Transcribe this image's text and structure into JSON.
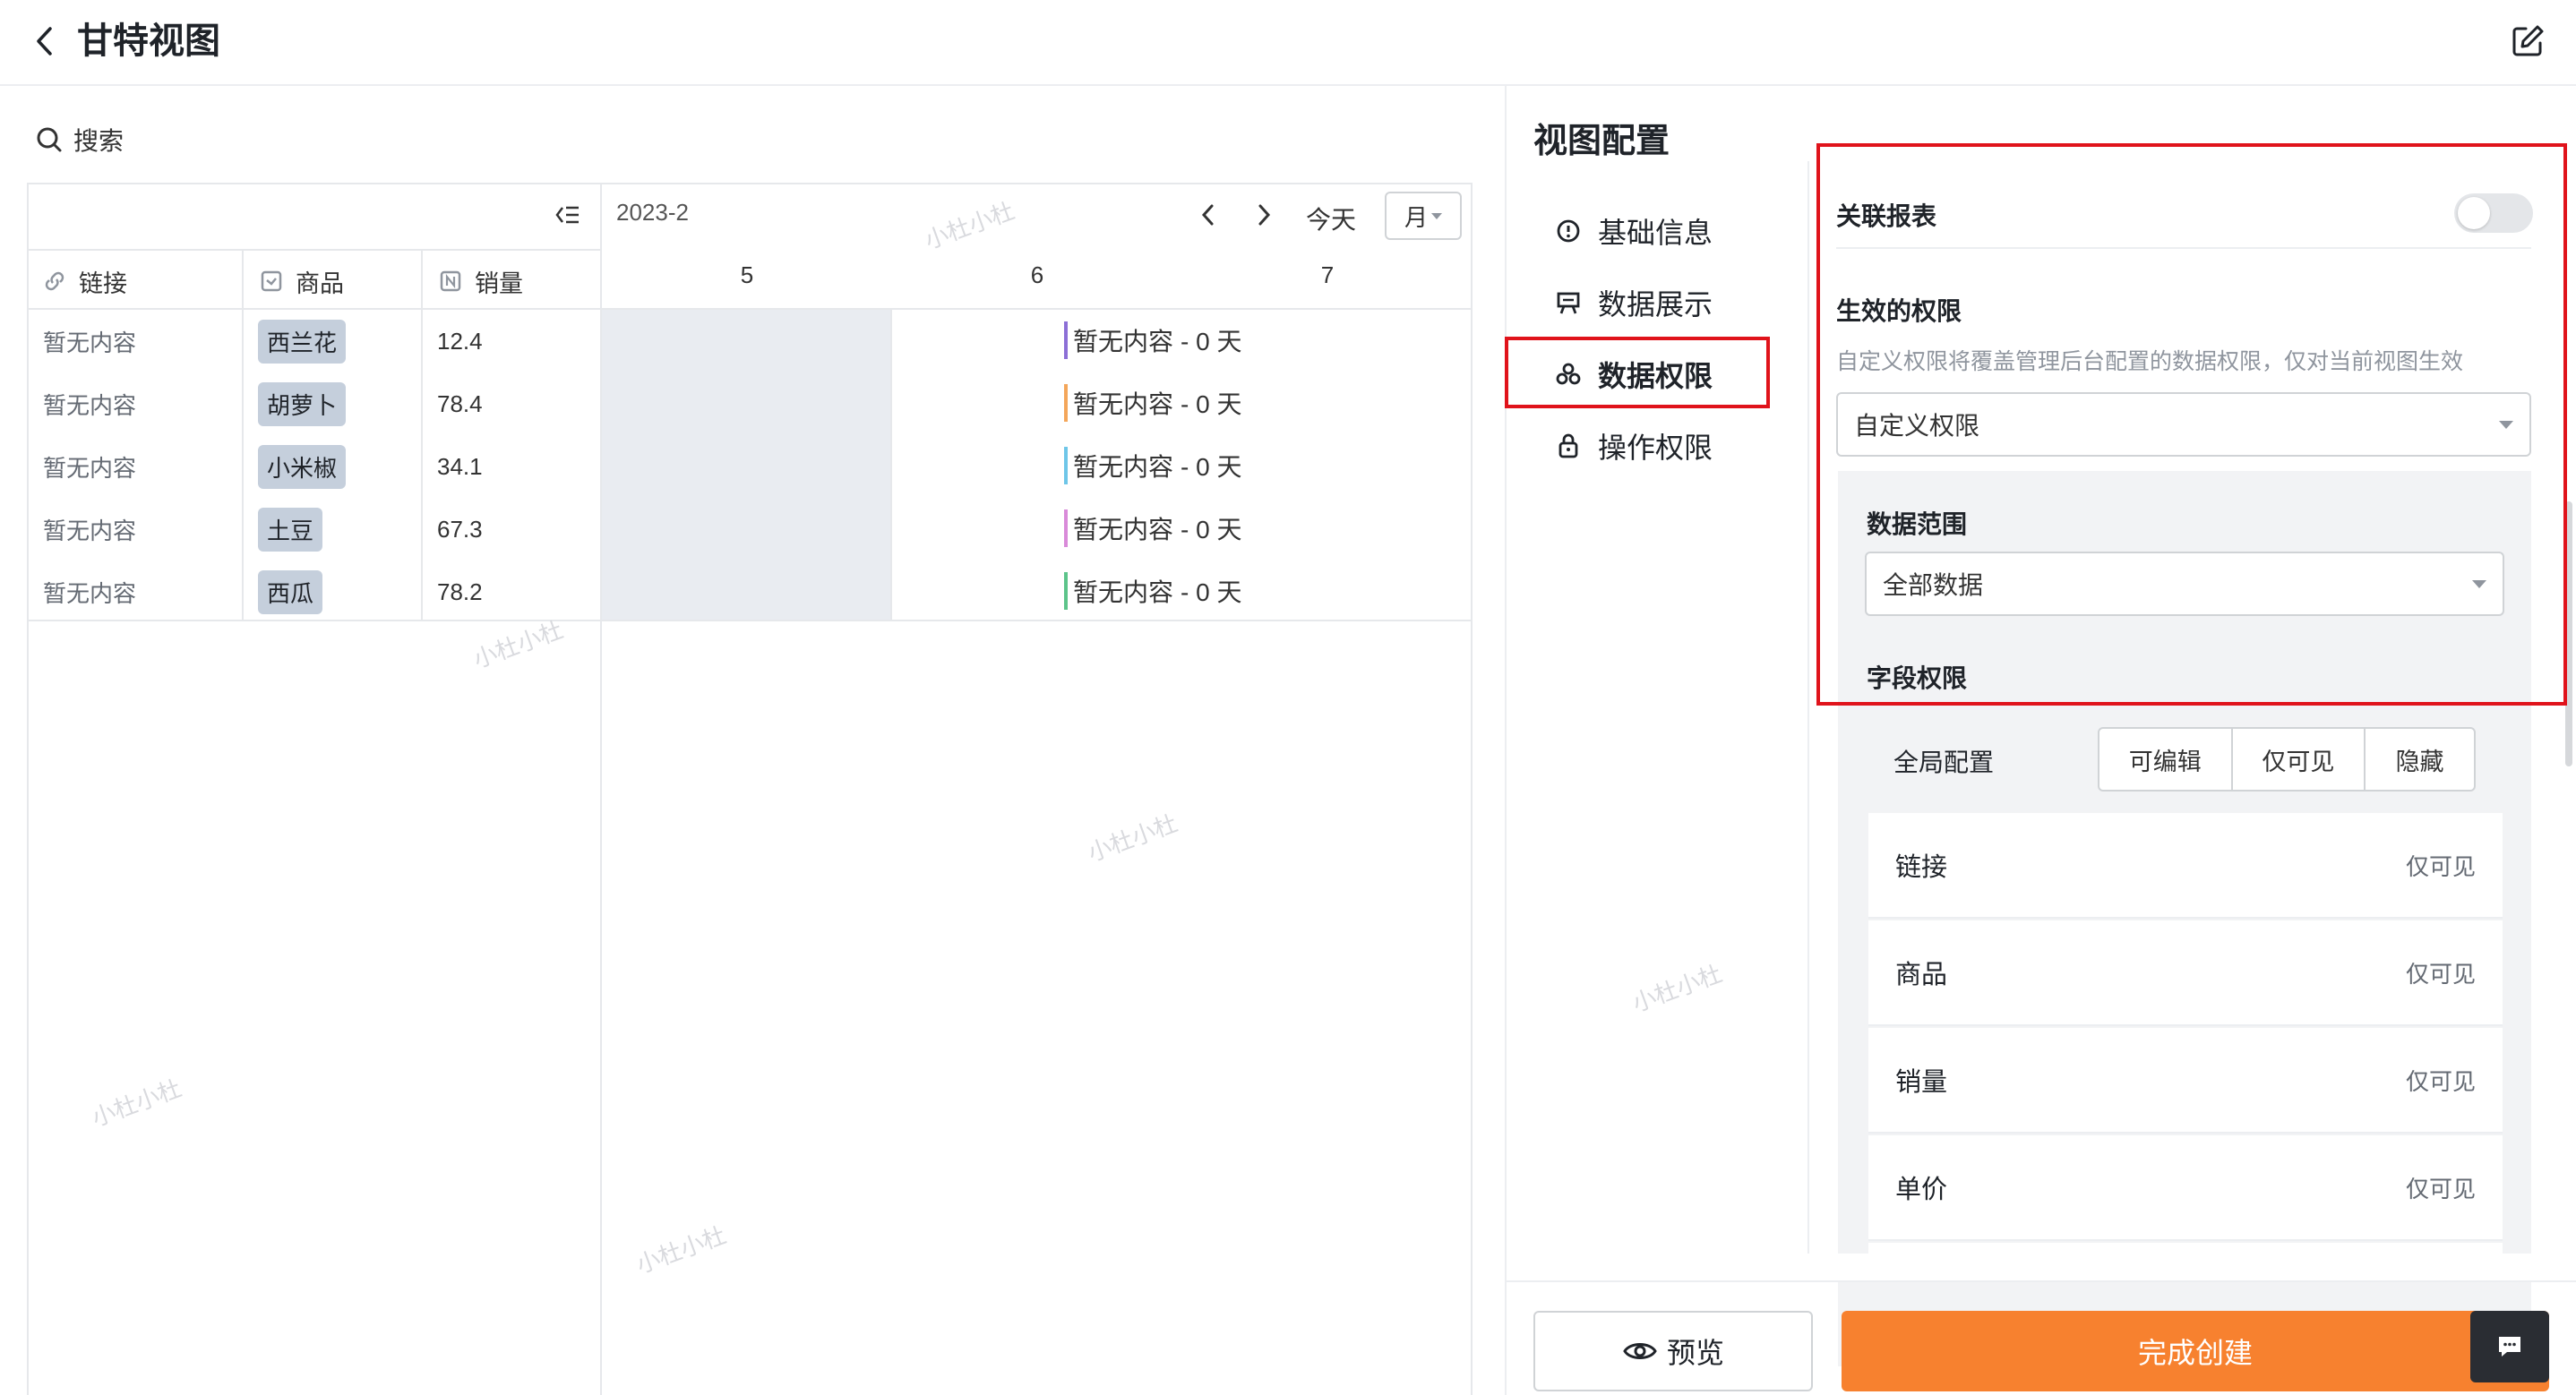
{
  "header": {
    "title": "甘特视图"
  },
  "search": {
    "label": "搜索"
  },
  "table": {
    "columns": [
      {
        "label": "链接",
        "icon": "link-icon"
      },
      {
        "label": "商品",
        "icon": "checkbox-icon"
      },
      {
        "label": "销量",
        "icon": "number-icon"
      }
    ],
    "rows": [
      {
        "link": "暂无内容",
        "product": "西兰花",
        "sales": "12.4"
      },
      {
        "link": "暂无内容",
        "product": "胡萝卜",
        "sales": "78.4"
      },
      {
        "link": "暂无内容",
        "product": "小米椒",
        "sales": "34.1"
      },
      {
        "link": "暂无内容",
        "product": "土豆",
        "sales": "67.3"
      },
      {
        "link": "暂无内容",
        "product": "西瓜",
        "sales": "78.2"
      }
    ]
  },
  "gantt": {
    "month": "2023-2",
    "today": "今天",
    "view": "月",
    "days": [
      "5",
      "6",
      "7"
    ],
    "bars": [
      {
        "text": "暂无内容",
        "duration": "- 0 天",
        "color": "#8c6fd6"
      },
      {
        "text": "暂无内容",
        "duration": "- 0 天",
        "color": "#f4a65a"
      },
      {
        "text": "暂无内容",
        "duration": "- 0 天",
        "color": "#6ec6e8"
      },
      {
        "text": "暂无内容",
        "duration": "- 0 天",
        "color": "#d98ad9"
      },
      {
        "text": "暂无内容",
        "duration": "- 0 天",
        "color": "#5cc48a"
      }
    ]
  },
  "watermark": "小杜小杜",
  "config": {
    "title": "视图配置",
    "nav": [
      {
        "label": "基础信息",
        "icon": "info-icon"
      },
      {
        "label": "数据展示",
        "icon": "display-icon"
      },
      {
        "label": "数据权限",
        "icon": "shield-icon",
        "active": true
      },
      {
        "label": "操作权限",
        "icon": "lock-icon"
      }
    ],
    "link_report": {
      "label": "关联报表",
      "enabled": false
    },
    "effective": {
      "label": "生效的权限",
      "desc": "自定义权限将覆盖管理后台配置的数据权限，仅对当前视图生效",
      "value": "自定义权限"
    },
    "scope": {
      "label": "数据范围",
      "value": "全部数据"
    },
    "field_perm": {
      "label": "字段权限",
      "global_label": "全局配置",
      "options": [
        "可编辑",
        "仅可见",
        "隐藏"
      ],
      "fields": [
        {
          "name": "链接",
          "value": "仅可见"
        },
        {
          "name": "商品",
          "value": "仅可见"
        },
        {
          "name": "销量",
          "value": "仅可见"
        },
        {
          "name": "单价",
          "value": "仅可见"
        }
      ]
    },
    "preview_label": "预览",
    "create_label": "完成创建"
  },
  "colors": {
    "accent": "#f7812f",
    "highlight": "#e0131b",
    "tag_bg": "#c5cfdc"
  }
}
